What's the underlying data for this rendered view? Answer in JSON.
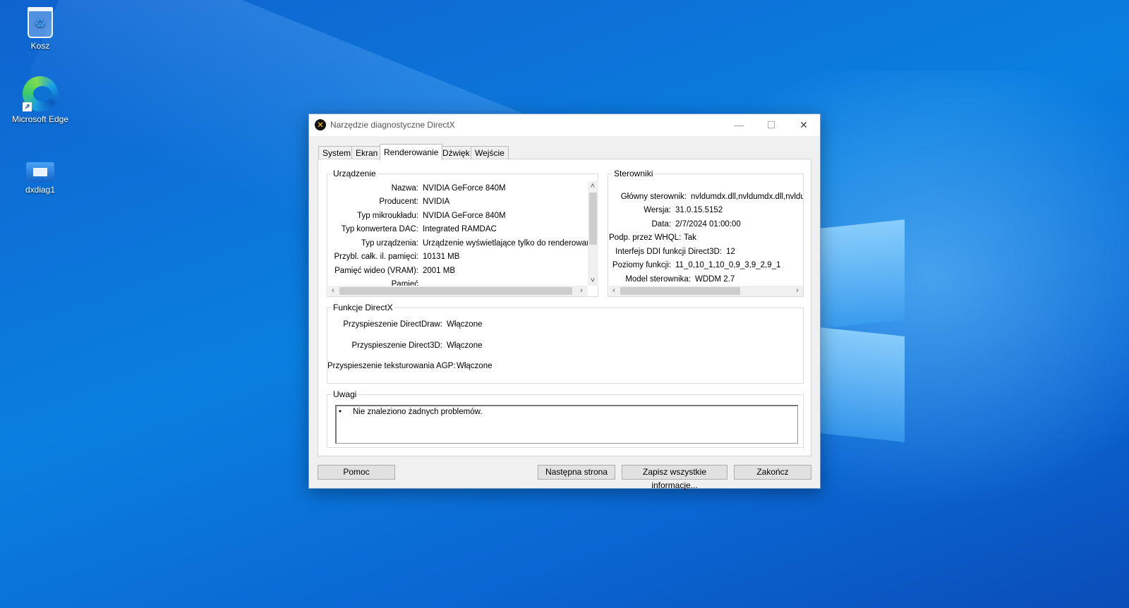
{
  "desktop": {
    "icons": [
      {
        "name": "recycle-bin",
        "label": "Kosz"
      },
      {
        "name": "edge",
        "label": "Microsoft Edge"
      },
      {
        "name": "dxdiag",
        "label": "dxdiag1"
      }
    ]
  },
  "window": {
    "title": "Narzędzie diagnostyczne DirectX",
    "controls": {
      "minimize": "—",
      "maximize": "☐",
      "close": "✕"
    }
  },
  "tabs": [
    "System",
    "Ekran",
    "Renderowanie",
    "Dźwięk",
    "Wejście"
  ],
  "active_tab": "Renderowanie",
  "device": {
    "title": "Urządzenie",
    "rows": [
      {
        "label": "Nazwa:",
        "value": "NVIDIA GeForce 840M"
      },
      {
        "label": "Producent:",
        "value": "NVIDIA"
      },
      {
        "label": "Typ mikroukładu:",
        "value": "NVIDIA GeForce 840M"
      },
      {
        "label": "Typ konwertera DAC:",
        "value": "Integrated RAMDAC"
      },
      {
        "label": "Typ urządzenia:",
        "value": "Urządzenie wyświetlające tylko do renderowania"
      },
      {
        "label": "Przybl. całk. il. pamięci:",
        "value": "10131 MB"
      },
      {
        "label": "Pamięć wideo (VRAM):",
        "value": "2001 MB"
      },
      {
        "label": "Pamięć",
        "value": ""
      }
    ]
  },
  "drivers": {
    "title": "Sterowniki",
    "rows": [
      {
        "label": "Główny sterownik:",
        "value": "nvldumdx.dll,nvldumdx.dll,nvldumdx.dll,nvldumdx.dll"
      },
      {
        "label": "Wersja:",
        "value": "31.0.15.5152"
      },
      {
        "label": "Data:",
        "value": "2/7/2024 01:00:00"
      },
      {
        "label": "Podp. przez WHQL:",
        "value": "Tak"
      },
      {
        "label": "Interfejs DDI funkcji Direct3D:",
        "value": "12"
      },
      {
        "label": "Poziomy funkcji:",
        "value": "11_0,10_1,10_0,9_3,9_2,9_1"
      },
      {
        "label": "Model sterownika:",
        "value": "WDDM 2.7"
      }
    ]
  },
  "directx": {
    "title": "Funkcje DirectX",
    "rows": [
      {
        "label": "Przyspieszenie DirectDraw:",
        "value": "Włączone"
      },
      {
        "label": "Przyspieszenie Direct3D:",
        "value": "Włączone"
      },
      {
        "label": "Przyspieszenie teksturowania AGP:",
        "value": "Włączone"
      }
    ]
  },
  "notes": {
    "title": "Uwagi",
    "items": [
      "Nie znaleziono żadnych problemów."
    ]
  },
  "buttons": {
    "help": "Pomoc",
    "next": "Następna strona",
    "save": "Zapisz wszystkie informacje...",
    "exit": "Zakończ"
  },
  "scroll_arrows": {
    "up": "˄",
    "down": "˅",
    "left": "‹",
    "right": "›"
  }
}
